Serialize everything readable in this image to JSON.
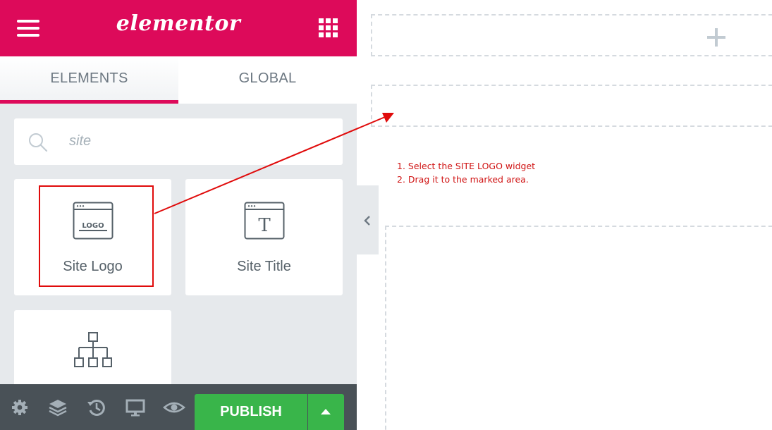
{
  "header": {
    "logo_text": "elementor",
    "brand_color": "#dd0a5a"
  },
  "tabs": [
    {
      "label": "ELEMENTS",
      "active": true
    },
    {
      "label": "GLOBAL",
      "active": false
    }
  ],
  "search": {
    "value": "site"
  },
  "widgets": [
    {
      "label": "Site Logo",
      "icon": "site-logo-icon",
      "icon_text": "LOGO",
      "highlighted": true
    },
    {
      "label": "Site Title",
      "icon": "site-title-icon",
      "icon_text": "T"
    },
    {
      "label": "",
      "icon": "nav-menu-icon"
    }
  ],
  "footer": {
    "icons": [
      "settings-icon",
      "navigator-layers-icon",
      "history-icon",
      "responsive-desktop-icon",
      "preview-eye-icon"
    ],
    "publish_label": "PUBLISH",
    "publish_color": "#39b54a"
  },
  "annotation": {
    "color": "#e00b0b",
    "lines": [
      "1. Select the SITE LOGO widget",
      "2. Drag it to the marked area."
    ]
  }
}
